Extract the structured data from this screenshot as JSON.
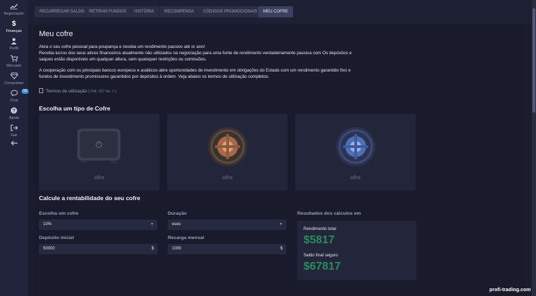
{
  "sidebar": {
    "items": [
      {
        "label": "Negociação",
        "icon": "chart-line-icon"
      },
      {
        "label": "Finanças",
        "icon": "dollar-icon"
      },
      {
        "label": "Perfil",
        "icon": "user-icon"
      },
      {
        "label": "Mercado",
        "icon": "cart-icon"
      },
      {
        "label": "Conquistas",
        "icon": "diamond-icon"
      },
      {
        "label": "Chat",
        "icon": "chat-icon",
        "badge": "15"
      },
      {
        "label": "Ajuda",
        "icon": "help-icon"
      },
      {
        "label": "Sair",
        "icon": "logout-icon"
      }
    ],
    "collapse_icon": "arrow-left-icon"
  },
  "tabs": [
    {
      "label": "RECARREGAR SALDO"
    },
    {
      "label": "RETIRAR FUNDOS"
    },
    {
      "label": "HISTÓRIA"
    },
    {
      "label": "RECOMPENSA"
    },
    {
      "label": "CÓDIGOS PROMOCIONAIS"
    },
    {
      "label": "MEU COFRE",
      "active": true
    }
  ],
  "page": {
    "title": "Meu cofre",
    "intro_line1": "Abra o seu cofre pessoal para poupança e receba um rendimento passivo até or ano!",
    "intro_line2": "Receba lucros dos seus ativos financeiros atualmente não utilizados na negociação para uma fonte de rendimento verdadeiramente passiva com Os depósitos e",
    "intro_line3": "saques estão disponíveis em qualquer altura, sem quaisquer restrições ou comissões.",
    "coop_line1": "A cooperação com os principais bancos europeus e asiáticos abre oportunidades de investimento em obrigações do Estado com um rendimento garantido fixo e",
    "coop_line2": "fundos de investimento promissores garantidos por depósitos à ordem. Veja abaixo os termos de utilização completos.",
    "terms_label": "Termos de utilização",
    "terms_meta": "[ Pdf, 327 kb ↗ ]"
  },
  "safe_section": {
    "heading": "Escolha um tipo de Cofre",
    "cards": [
      {
        "caption": "ofre"
      },
      {
        "caption": "ofre"
      },
      {
        "caption": "ofre"
      }
    ]
  },
  "calculator": {
    "heading": "Calcule a rentabilidade do seu cofre",
    "safe_label": "Escolha um cofre",
    "safe_value": "10%",
    "duration_label": "Duração",
    "duration_value": "eses",
    "deposit_label": "Depósito inicial",
    "deposit_value": "50000",
    "deposit_suffix": "$",
    "monthly_label": "Recarga mensal",
    "monthly_value": "1000",
    "monthly_suffix": "$",
    "results_label": "Resultados dos cálculos em",
    "total_label": "Rendimento total",
    "total_value": "$5817",
    "final_label": "Saldo final seguro",
    "final_value": "$67817"
  },
  "watermark": "profi-trading.com",
  "colors": {
    "accent_green": "#2c8b5f",
    "badge_blue": "#3c8fd6",
    "background": "#1b1d2e"
  }
}
